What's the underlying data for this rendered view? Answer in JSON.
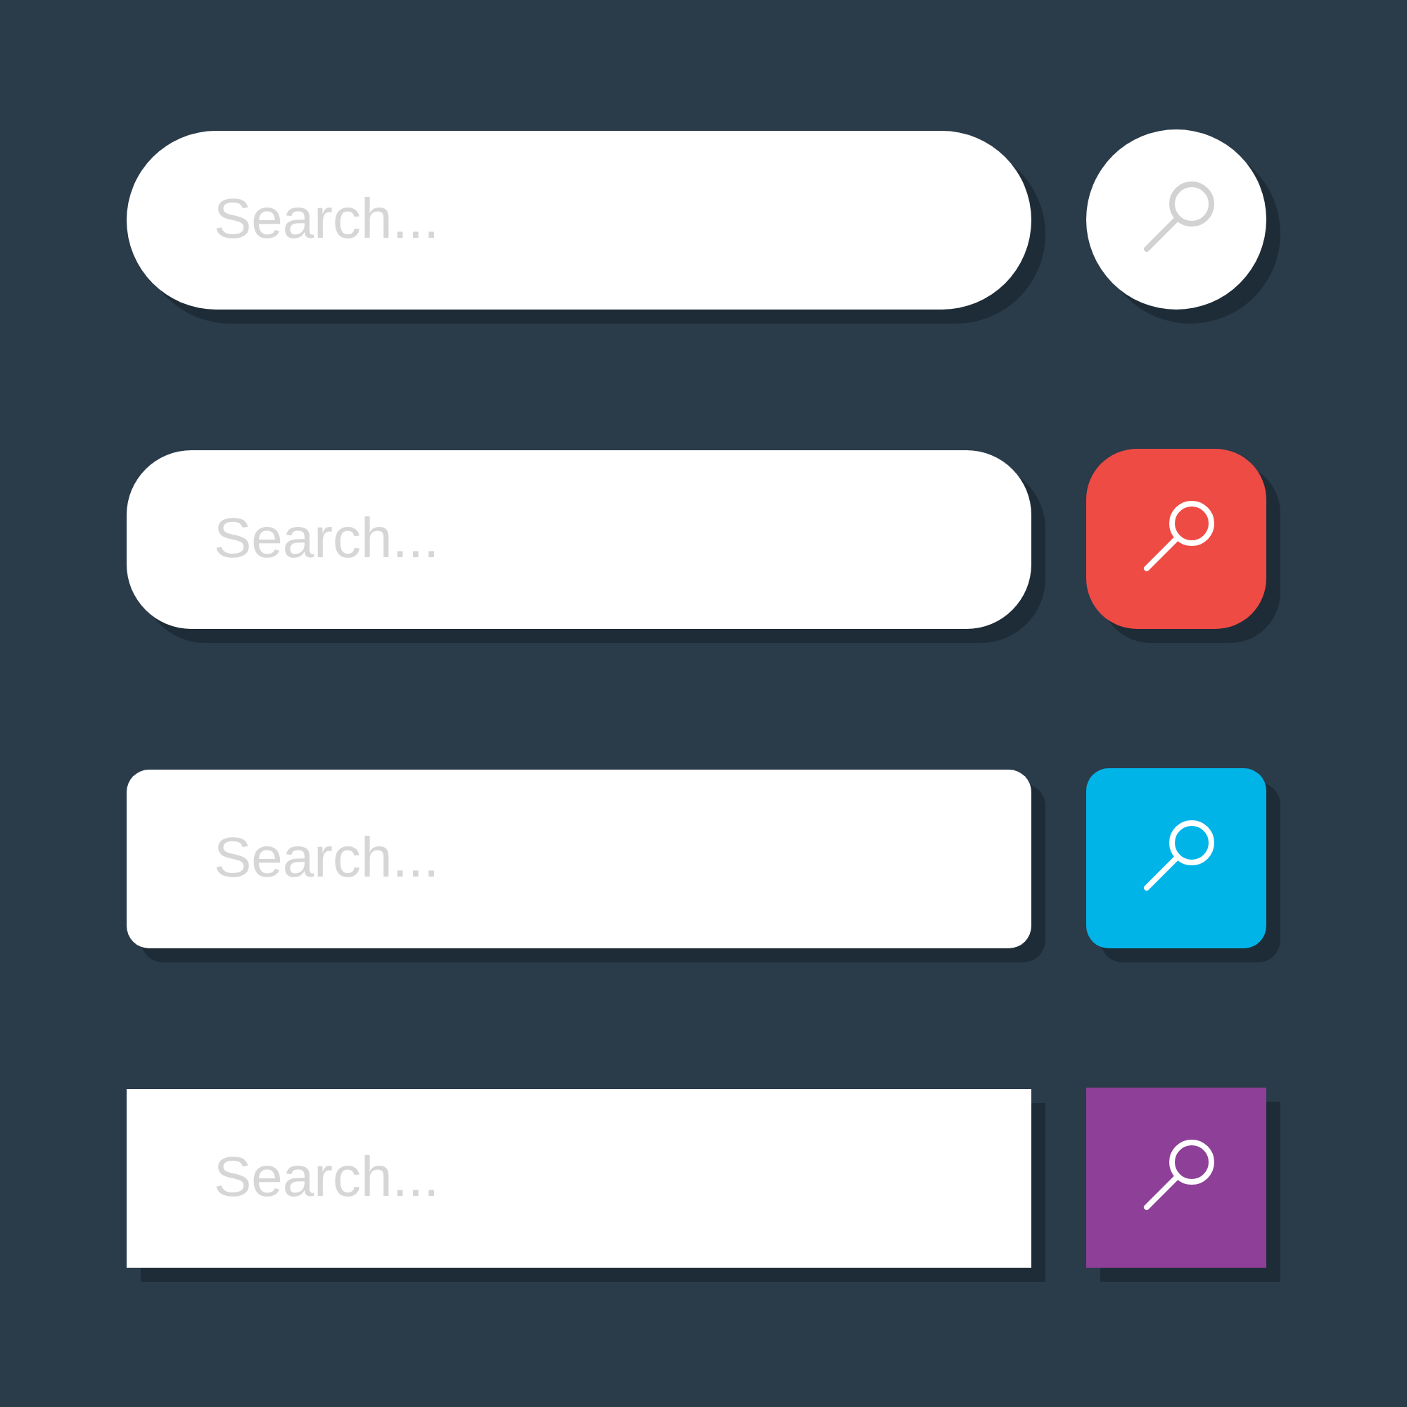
{
  "search_bars": [
    {
      "kind": "pill",
      "placeholder": "Search...",
      "button": {
        "color": "#ffffff"
      }
    },
    {
      "kind": "rounded",
      "placeholder": "Search...",
      "button": {
        "color": "#ef4b45"
      }
    },
    {
      "kind": "soft",
      "placeholder": "Search...",
      "button": {
        "color": "#00b4e8"
      }
    },
    {
      "kind": "square",
      "placeholder": "Search...",
      "button": {
        "color": "#8e3f97"
      }
    }
  ]
}
